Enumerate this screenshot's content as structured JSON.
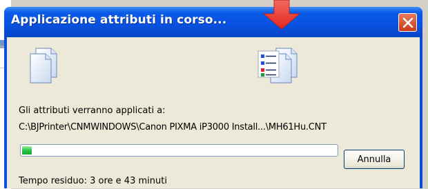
{
  "window": {
    "title": "Applicazione attributi in corso..."
  },
  "icons": {
    "source": "documents-icon",
    "destination": "document-attributes-icon"
  },
  "content": {
    "applied_label": "Gli attributi verranno applicati a:",
    "path": "C:\\BJPrinter\\CNMWINDOWS\\Canon PIXMA iP3000 Install...\\MH61Hu.CNT",
    "progress_percent": 3,
    "time_remaining": "Tempo residuo: 3 ore e 43 minuti"
  },
  "buttons": {
    "cancel_label": "Annulla"
  },
  "colors": {
    "titlebar": "#0751e0",
    "close": "#c83a18",
    "progress": "#2cc447",
    "annotation_arrow": "#ee3a31"
  }
}
